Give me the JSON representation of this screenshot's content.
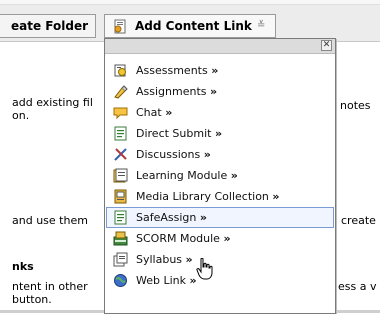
{
  "toolbar": {
    "create_folder_label": "eate Folder",
    "add_content_link_label": "Add Content Link",
    "chevron": "≚"
  },
  "background": {
    "row1_left_line1": "add existing fil",
    "row1_left_line2": "on.",
    "row1_right": "notes",
    "row2_left": "and use them",
    "row2_right": "create",
    "section_heading": "nks",
    "row3_left_line1": "ntent in other",
    "row3_left_line2": "button.",
    "row3_right": "ess a v"
  },
  "menu": {
    "close_glyph": "✕",
    "items": [
      {
        "label": "Assessments",
        "icon": "assessment-icon"
      },
      {
        "label": "Assignments",
        "icon": "assignment-icon"
      },
      {
        "label": "Chat",
        "icon": "chat-icon"
      },
      {
        "label": "Direct Submit",
        "icon": "direct-submit-icon"
      },
      {
        "label": "Discussions",
        "icon": "discussion-icon"
      },
      {
        "label": "Learning Module",
        "icon": "learning-module-icon"
      },
      {
        "label": "Media Library Collection",
        "icon": "media-library-icon"
      },
      {
        "label": "SafeAssign",
        "icon": "safeassign-icon"
      },
      {
        "label": "SCORM Module",
        "icon": "scorm-icon"
      },
      {
        "label": "Syllabus",
        "icon": "syllabus-icon"
      },
      {
        "label": "Web Link",
        "icon": "web-link-icon"
      }
    ],
    "suffix": "»"
  },
  "colors": {
    "toolbar_bg": "#ececec",
    "highlight_border": "#7a9bd4",
    "highlight_bg": "#f1f5ff"
  }
}
